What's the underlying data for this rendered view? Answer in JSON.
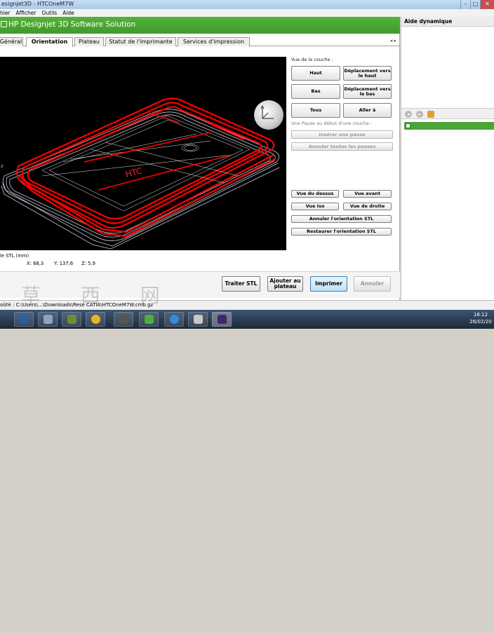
{
  "window": {
    "title": "esignjet3D - HTCOneM7W",
    "minimize_glyph": "–",
    "maximize_glyph": "□",
    "close_glyph": "✕"
  },
  "menu": [
    "hier",
    "Afficher",
    "Outils",
    "Aide"
  ],
  "app": {
    "name": "HP Designjet 3D Software Solution",
    "accent": "#4caf37"
  },
  "tabs": [
    {
      "label": "Général",
      "active": false
    },
    {
      "label": "Orientation",
      "active": true
    },
    {
      "label": "Plateau",
      "active": false
    },
    {
      "label": "Statut de l'imprimante",
      "active": false
    },
    {
      "label": "Services d'impression",
      "active": false
    }
  ],
  "tab_arrows": "◂ ▸",
  "viewport": {
    "model_text": "HTC",
    "axis_marker": "z"
  },
  "panel": {
    "layer_view_label": "Vue de la couche :",
    "btn_haut": "Haut",
    "btn_move_up": "Déplacement vers le haut",
    "btn_bas": "Bas",
    "btn_move_down": "Déplacement vers le bas",
    "btn_tous": "Tous",
    "btn_goto": "Aller à",
    "pause_label": "Une Pause au début d'une couche :",
    "btn_insert_pause": "Insérer une pause",
    "btn_cancel_pauses": "Annuler toutes les pauses",
    "btn_view_top": "Vue du dessus",
    "btn_view_front": "Vue avant",
    "btn_view_iso": "Vue Iso",
    "btn_view_right": "Vue de droite",
    "btn_cancel_stl": "Annuler l'orientation STL",
    "btn_restore_stl": "Restaurer l'orientation STL"
  },
  "coords": {
    "unit_label": "le STL (mm)",
    "x": "X: 68,3",
    "y": "Y: 137,6",
    "z": "Z: 5,9"
  },
  "bottom": {
    "btn_process": "Traiter STL",
    "btn_add": "Ajouter au plateau",
    "btn_print": "Imprimer",
    "btn_cancel": "Annuler"
  },
  "status": "oûté : C:\\Users\\...\\Downloads\\Rese CATIA\\HTCOneM7W.cmb.gz",
  "help": {
    "title": "Aide dynamique",
    "back_icon": "◂",
    "forward_icon": "▸"
  },
  "taskbar": {
    "time": "18:12",
    "date": "26/02/20"
  },
  "watermark": "草 西 网",
  "watermark2": "www.cad..."
}
